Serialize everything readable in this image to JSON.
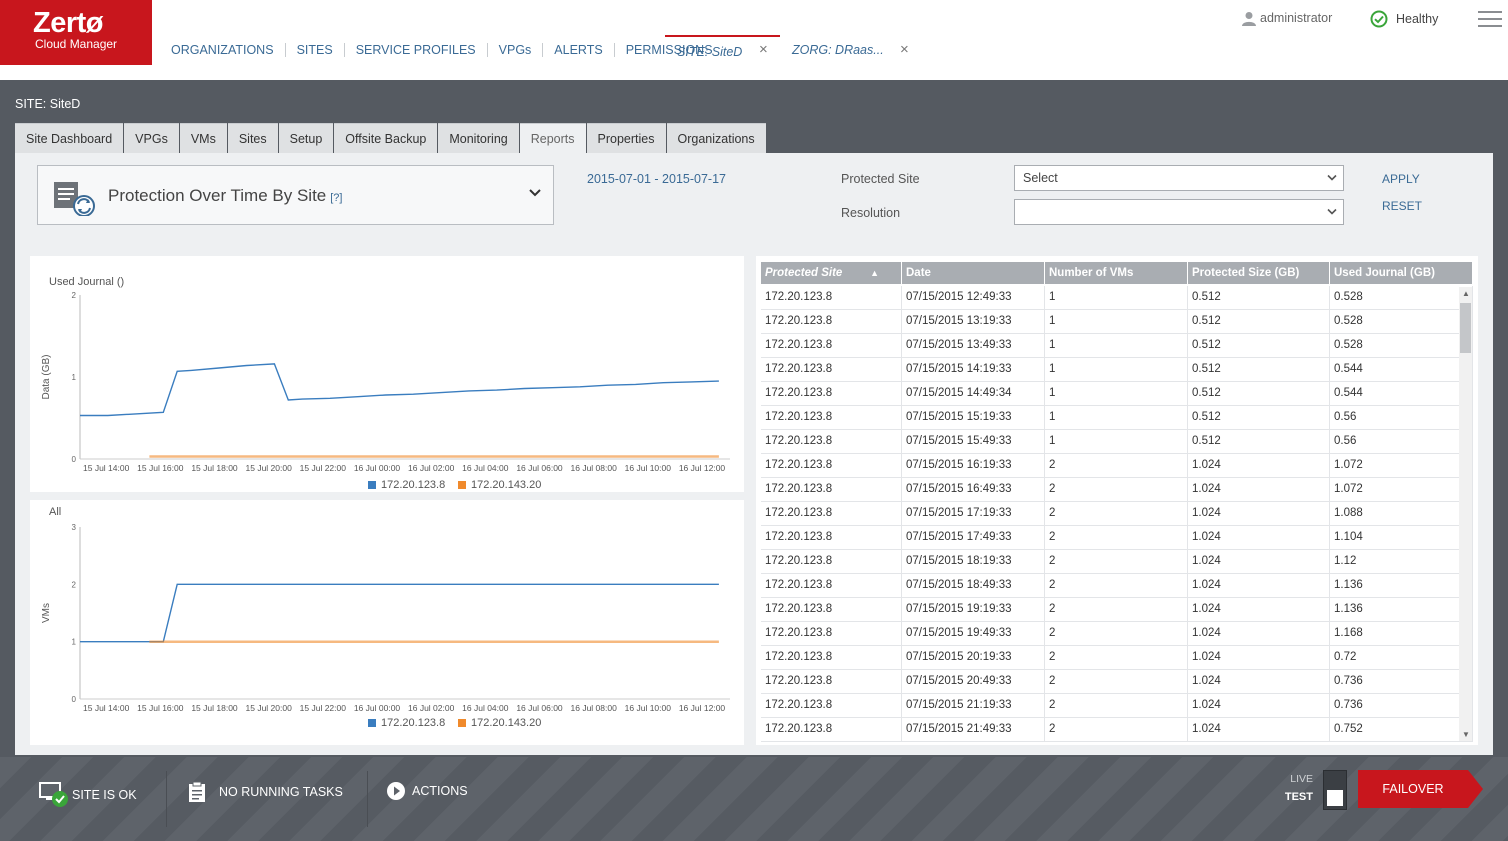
{
  "app": {
    "brand": "Zertø",
    "subtitle": "Cloud Manager"
  },
  "nav": {
    "items": [
      "ORGANIZATIONS",
      "SITES",
      "SERVICE PROFILES",
      "VPGs",
      "ALERTS",
      "PERMISSIONS"
    ],
    "open_tabs": [
      "SITE: SiteD",
      "ZORG: DRaas..."
    ],
    "close_glyph": "×"
  },
  "user": {
    "name": "administrator"
  },
  "health": {
    "label": "Healthy",
    "color": "#3aa53a"
  },
  "site": {
    "label": "SITE: SiteD",
    "tabs": [
      "Site Dashboard",
      "VPGs",
      "VMs",
      "Sites",
      "Setup",
      "Offsite Backup",
      "Monitoring",
      "Reports",
      "Properties",
      "Organizations"
    ],
    "active_tab": "Reports"
  },
  "report": {
    "title": "Protection Over Time By Site",
    "help": "[?]",
    "date_range": "2015-07-01 - 2015-07-17",
    "protected_site_label": "Protected Site",
    "protected_site_value": "Select",
    "resolution_label": "Resolution",
    "resolution_value": "",
    "apply": "APPLY",
    "reset": "RESET"
  },
  "chart_data": [
    {
      "type": "line",
      "title": "Used Journal ()",
      "ylabel": "Data (GB)",
      "ylim": [
        0,
        2
      ],
      "yticks": [
        "0",
        "1",
        "2"
      ],
      "xticks": [
        "15 Jul 14:00",
        "15 Jul 16:00",
        "15 Jul 18:00",
        "15 Jul 20:00",
        "15 Jul 22:00",
        "16 Jul 00:00",
        "16 Jul 02:00",
        "16 Jul 04:00",
        "16 Jul 06:00",
        "16 Jul 08:00",
        "16 Jul 10:00",
        "16 Jul 12:00"
      ],
      "xlim": [
        13.0,
        36.4
      ],
      "legend_position": "bottom",
      "series": [
        {
          "name": "172.20.123.8",
          "color": "#3a7dbf",
          "x": [
            13.0,
            14.0,
            15.0,
            16.0,
            16.5,
            17.0,
            18.0,
            19.0,
            20.0,
            20.5,
            21.0,
            22.0,
            23.0,
            24.0,
            25.0,
            26.0,
            27.0,
            28.0,
            29.0,
            30.0,
            31.0,
            32.0,
            33.0,
            34.0,
            35.0,
            36.0
          ],
          "y": [
            0.53,
            0.53,
            0.55,
            0.57,
            1.07,
            1.08,
            1.11,
            1.14,
            1.16,
            0.72,
            0.73,
            0.74,
            0.76,
            0.78,
            0.79,
            0.81,
            0.83,
            0.84,
            0.86,
            0.87,
            0.88,
            0.9,
            0.91,
            0.93,
            0.94,
            0.95
          ]
        },
        {
          "name": "172.20.143.20",
          "color": "#f08a2c",
          "x": [
            15.5,
            36.0
          ],
          "y": [
            0.03,
            0.03
          ]
        }
      ]
    },
    {
      "type": "line",
      "title": "All",
      "ylabel": "VMs",
      "ylim": [
        0,
        3
      ],
      "yticks": [
        "0",
        "1",
        "2",
        "3"
      ],
      "xticks": [
        "15 Jul 14:00",
        "15 Jul 16:00",
        "15 Jul 18:00",
        "15 Jul 20:00",
        "15 Jul 22:00",
        "16 Jul 00:00",
        "16 Jul 02:00",
        "16 Jul 04:00",
        "16 Jul 06:00",
        "16 Jul 08:00",
        "16 Jul 10:00",
        "16 Jul 12:00"
      ],
      "xlim": [
        13.0,
        36.4
      ],
      "legend_position": "bottom",
      "series": [
        {
          "name": "172.20.123.8",
          "color": "#3a7dbf",
          "x": [
            13.0,
            16.0,
            16.5,
            36.0
          ],
          "y": [
            1,
            1,
            2,
            2
          ]
        },
        {
          "name": "172.20.143.20",
          "color": "#f08a2c",
          "x": [
            15.5,
            36.0
          ],
          "y": [
            1,
            1
          ]
        }
      ]
    }
  ],
  "table": {
    "columns": [
      "Protected Site",
      "Date",
      "Number of VMs",
      "Protected Size (GB)",
      "Used Journal (GB)"
    ],
    "sorted_column": "Protected Site",
    "rows": [
      [
        "172.20.123.8",
        "07/15/2015 12:49:33",
        "1",
        "0.512",
        "0.528"
      ],
      [
        "172.20.123.8",
        "07/15/2015 13:19:33",
        "1",
        "0.512",
        "0.528"
      ],
      [
        "172.20.123.8",
        "07/15/2015 13:49:33",
        "1",
        "0.512",
        "0.528"
      ],
      [
        "172.20.123.8",
        "07/15/2015 14:19:33",
        "1",
        "0.512",
        "0.544"
      ],
      [
        "172.20.123.8",
        "07/15/2015 14:49:34",
        "1",
        "0.512",
        "0.544"
      ],
      [
        "172.20.123.8",
        "07/15/2015 15:19:33",
        "1",
        "0.512",
        "0.56"
      ],
      [
        "172.20.123.8",
        "07/15/2015 15:49:33",
        "1",
        "0.512",
        "0.56"
      ],
      [
        "172.20.123.8",
        "07/15/2015 16:19:33",
        "2",
        "1.024",
        "1.072"
      ],
      [
        "172.20.123.8",
        "07/15/2015 16:49:33",
        "2",
        "1.024",
        "1.072"
      ],
      [
        "172.20.123.8",
        "07/15/2015 17:19:33",
        "2",
        "1.024",
        "1.088"
      ],
      [
        "172.20.123.8",
        "07/15/2015 17:49:33",
        "2",
        "1.024",
        "1.104"
      ],
      [
        "172.20.123.8",
        "07/15/2015 18:19:33",
        "2",
        "1.024",
        "1.12"
      ],
      [
        "172.20.123.8",
        "07/15/2015 18:49:33",
        "2",
        "1.024",
        "1.136"
      ],
      [
        "172.20.123.8",
        "07/15/2015 19:19:33",
        "2",
        "1.024",
        "1.136"
      ],
      [
        "172.20.123.8",
        "07/15/2015 19:49:33",
        "2",
        "1.024",
        "1.168"
      ],
      [
        "172.20.123.8",
        "07/15/2015 20:19:33",
        "2",
        "1.024",
        "0.72"
      ],
      [
        "172.20.123.8",
        "07/15/2015 20:49:33",
        "2",
        "1.024",
        "0.736"
      ],
      [
        "172.20.123.8",
        "07/15/2015 21:19:33",
        "2",
        "1.024",
        "0.736"
      ],
      [
        "172.20.123.8",
        "07/15/2015 21:49:33",
        "2",
        "1.024",
        "0.752"
      ]
    ]
  },
  "footer": {
    "site_status": "SITE IS OK",
    "tasks": "NO RUNNING TASKS",
    "actions": "ACTIONS",
    "live": "LIVE",
    "test": "TEST",
    "failover": "FAILOVER",
    "failover_color": "#c8161d"
  }
}
